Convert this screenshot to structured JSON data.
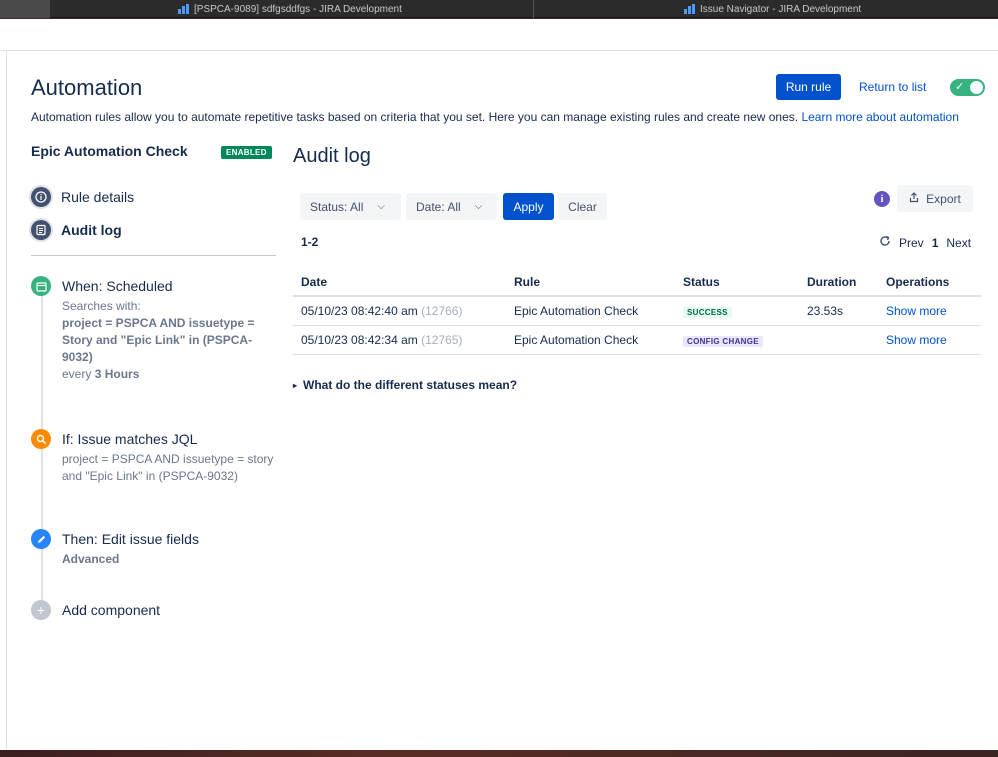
{
  "browser": {
    "tabs": [
      {
        "label": "[PSPCA-9089] sdfgsddfgs - JIRA Development"
      },
      {
        "label": "Issue Navigator - JIRA Development"
      }
    ]
  },
  "header": {
    "title": "Automation",
    "description": "Automation rules allow you to automate repetitive tasks based on criteria that you set. Here you can manage existing rules and create new ones.",
    "learn_more": "Learn more about automation",
    "run_rule": "Run rule",
    "return_to_list": "Return to list",
    "toggle_enabled": true
  },
  "sidebar": {
    "rule_name": "Epic Automation Check",
    "status": "ENABLED",
    "nav": [
      {
        "label": "Rule details",
        "icon": "info-icon"
      },
      {
        "label": "Audit log",
        "icon": "audit-log-icon"
      }
    ],
    "steps": [
      {
        "heading": "When: Scheduled",
        "line1": "Searches with:",
        "jql": "project = PSPCA AND issuetype = Story and \"Epic Link\" in (PSPCA-9032)",
        "every_prefix": "every",
        "every_value": "3 Hours",
        "icon": "calendar-icon",
        "color": "#36b37e"
      },
      {
        "heading": "If: Issue matches JQL",
        "body": "project = PSPCA AND issuetype = story and \"Epic Link\" in (PSPCA-9032)",
        "icon": "search-icon",
        "color": "#ff8b00"
      },
      {
        "heading": "Then: Edit issue fields",
        "body": "Advanced",
        "icon": "pencil-icon",
        "color": "#2684ff"
      },
      {
        "heading": "Add component",
        "icon": "plus-icon",
        "color": "#c1c7d0"
      }
    ]
  },
  "audit": {
    "title": "Audit log",
    "filters": {
      "status": "Status: All",
      "date": "Date: All",
      "apply": "Apply",
      "clear": "Clear"
    },
    "export": "Export",
    "range": "1-2",
    "pager": {
      "prev": "Prev",
      "current": "1",
      "next": "Next"
    },
    "columns": [
      "Date",
      "Rule",
      "Status",
      "Duration",
      "Operations"
    ],
    "rows": [
      {
        "date": "05/10/23 08:42:40 am",
        "id": "(12766)",
        "rule": "Epic Automation Check",
        "status": "SUCCESS",
        "duration": "23.53s",
        "operation": "Show more"
      },
      {
        "date": "05/10/23 08:42:34 am",
        "id": "(12765)",
        "rule": "Epic Automation Check",
        "status": "CONFIG CHANGE",
        "duration": "",
        "operation": "Show more"
      }
    ],
    "faq": "What do the different statuses mean?"
  }
}
